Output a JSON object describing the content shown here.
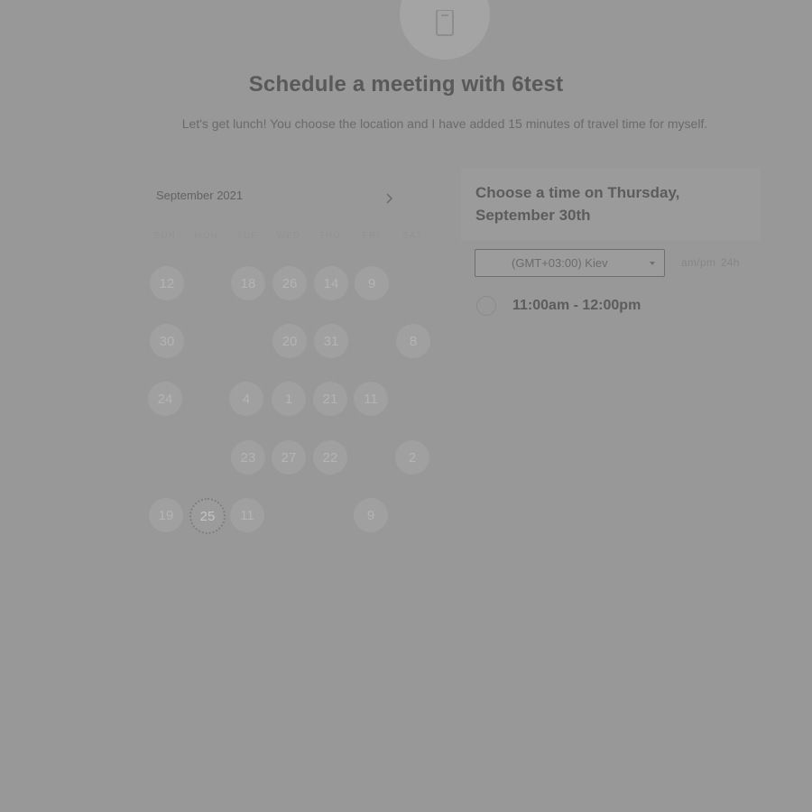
{
  "header": {
    "title": "Schedule a meeting with 6test",
    "subtitle": "Let's get lunch! You choose the location and I have added 15 minutes of travel time for myself."
  },
  "calendar": {
    "month": "September 2021",
    "weekdays": [
      "SUN",
      "MON",
      "TUE",
      "WED",
      "THU",
      "FRI",
      "SAT"
    ],
    "days": [
      "12",
      "18",
      "26",
      "14",
      "9",
      "30",
      "20",
      "31",
      "8",
      "24",
      "4",
      "1",
      "21",
      "11",
      "23",
      "27",
      "22",
      "2",
      "19",
      "25",
      "11",
      "9"
    ],
    "selected_day": "25"
  },
  "booking": {
    "panel_title": "Choose a time on Thursday, September 30th",
    "timezone": "(GMT+03:00) Kiev",
    "format_ampm": "am/pm",
    "format_24h": "24h",
    "slots": [
      "11:00am - 12:00pm"
    ]
  }
}
